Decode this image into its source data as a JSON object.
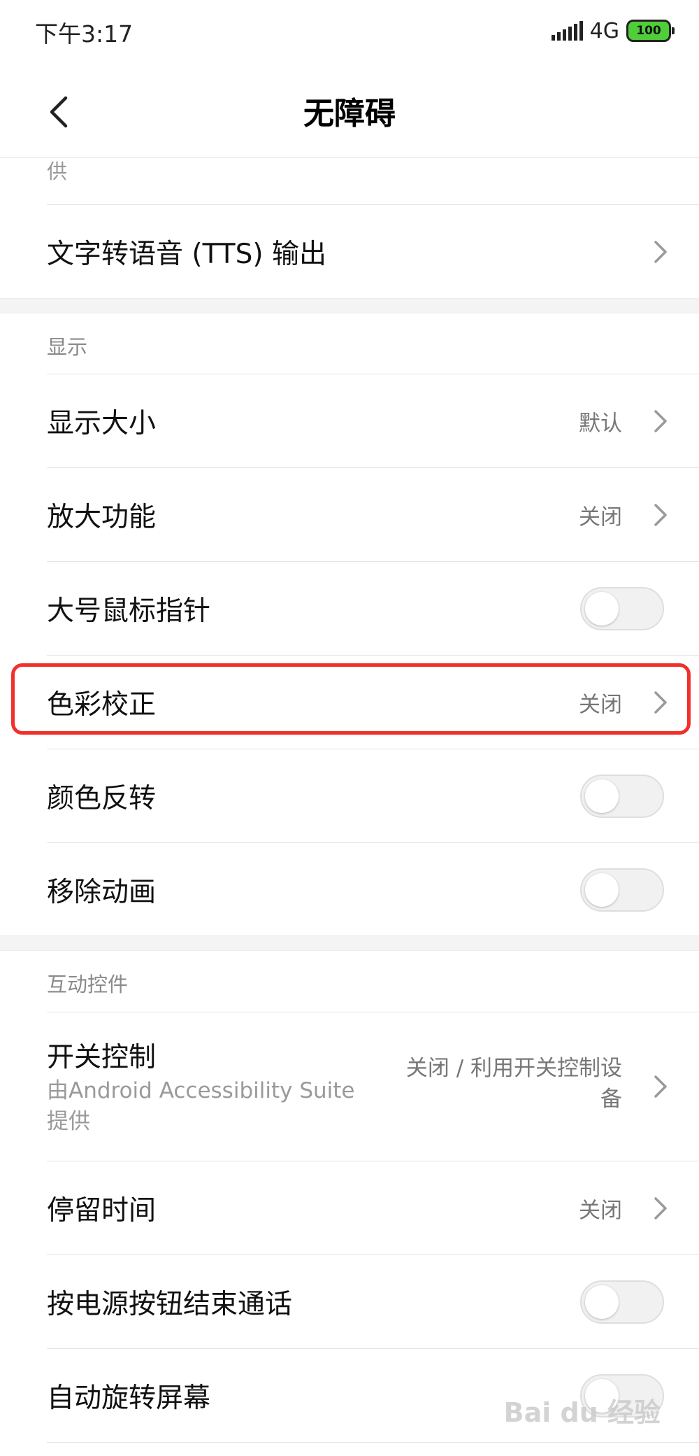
{
  "status_bar": {
    "time": "下午3:17",
    "network": "4G",
    "battery": "100"
  },
  "header": {
    "title": "无障碍",
    "back_icon": "chevron-left-icon"
  },
  "partial_text": "供",
  "items": {
    "tts": {
      "label": "文字转语音 (TTS) 输出"
    },
    "display_section": "显示",
    "display_size": {
      "label": "显示大小",
      "value": "默认"
    },
    "magnification": {
      "label": "放大功能",
      "value": "关闭"
    },
    "large_pointer": {
      "label": "大号鼠标指针",
      "toggle": false
    },
    "color_correction": {
      "label": "色彩校正",
      "value": "关闭"
    },
    "color_inversion": {
      "label": "颜色反转",
      "toggle": false
    },
    "remove_animations": {
      "label": "移除动画",
      "toggle": false
    },
    "interaction_section": "互动控件",
    "switch_control": {
      "label": "开关控制",
      "subtitle": "由Android Accessibility Suite提供",
      "value": "关闭 / 利用开关控制设备"
    },
    "dwell_time": {
      "label": "停留时间",
      "value": "关闭"
    },
    "power_ends_call": {
      "label": "按电源按钮结束通话",
      "toggle": false
    },
    "auto_rotate": {
      "label": "自动旋转屏幕",
      "toggle": false
    }
  },
  "watermark": "Bai du 经验",
  "colors": {
    "highlight": "#f2302a",
    "battery": "#4fce3a"
  }
}
